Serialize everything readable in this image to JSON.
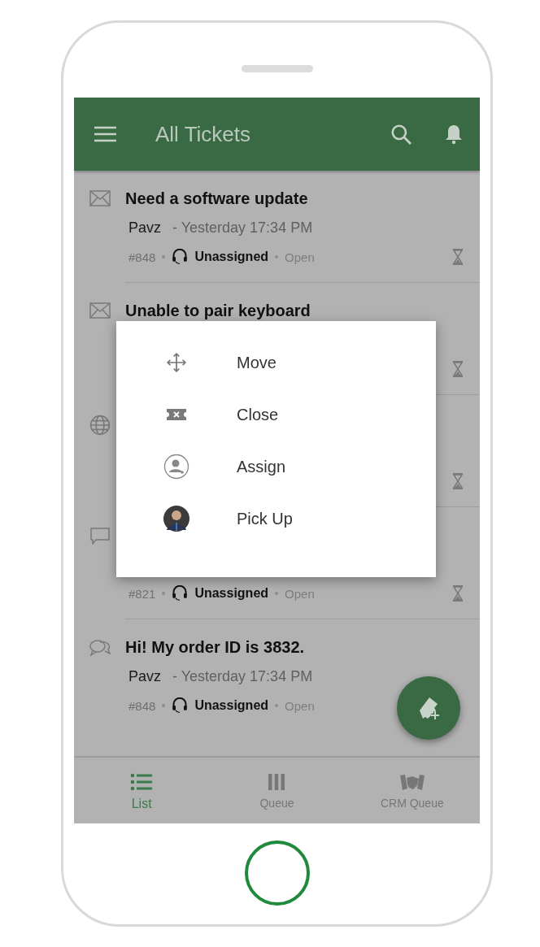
{
  "header": {
    "title": "All Tickets"
  },
  "tickets": [
    {
      "kind": "mail",
      "title": "Need a software update",
      "author": "Pavz",
      "time": "- Yesterday 17:34 PM",
      "number": "#848",
      "assignee": "Unassigned",
      "status": "Open",
      "waiting": true
    },
    {
      "kind": "mail",
      "title": "Unable to pair keyboard",
      "waiting": true
    },
    {
      "kind": "globe",
      "waiting": true
    },
    {
      "kind": "comment",
      "number": "#821",
      "assignee": "Unassigned",
      "status": "Open",
      "waiting": true
    },
    {
      "kind": "chat",
      "title": "Hi! My order ID is 3832.",
      "author": "Pavz",
      "time": "- Yesterday 17:34 PM",
      "number": "#848",
      "assignee": "Unassigned",
      "status": "Open",
      "waiting": false
    }
  ],
  "menu": [
    {
      "kind": "move",
      "label": "Move"
    },
    {
      "kind": "close",
      "label": "Close"
    },
    {
      "kind": "assign",
      "label": "Assign"
    },
    {
      "kind": "avatar",
      "label": "Pick Up"
    }
  ],
  "nav": [
    {
      "kind": "list",
      "label": "List",
      "selected": true
    },
    {
      "kind": "queue",
      "label": "Queue",
      "selected": false
    },
    {
      "kind": "crm",
      "label": "CRM Queue",
      "selected": false
    }
  ]
}
